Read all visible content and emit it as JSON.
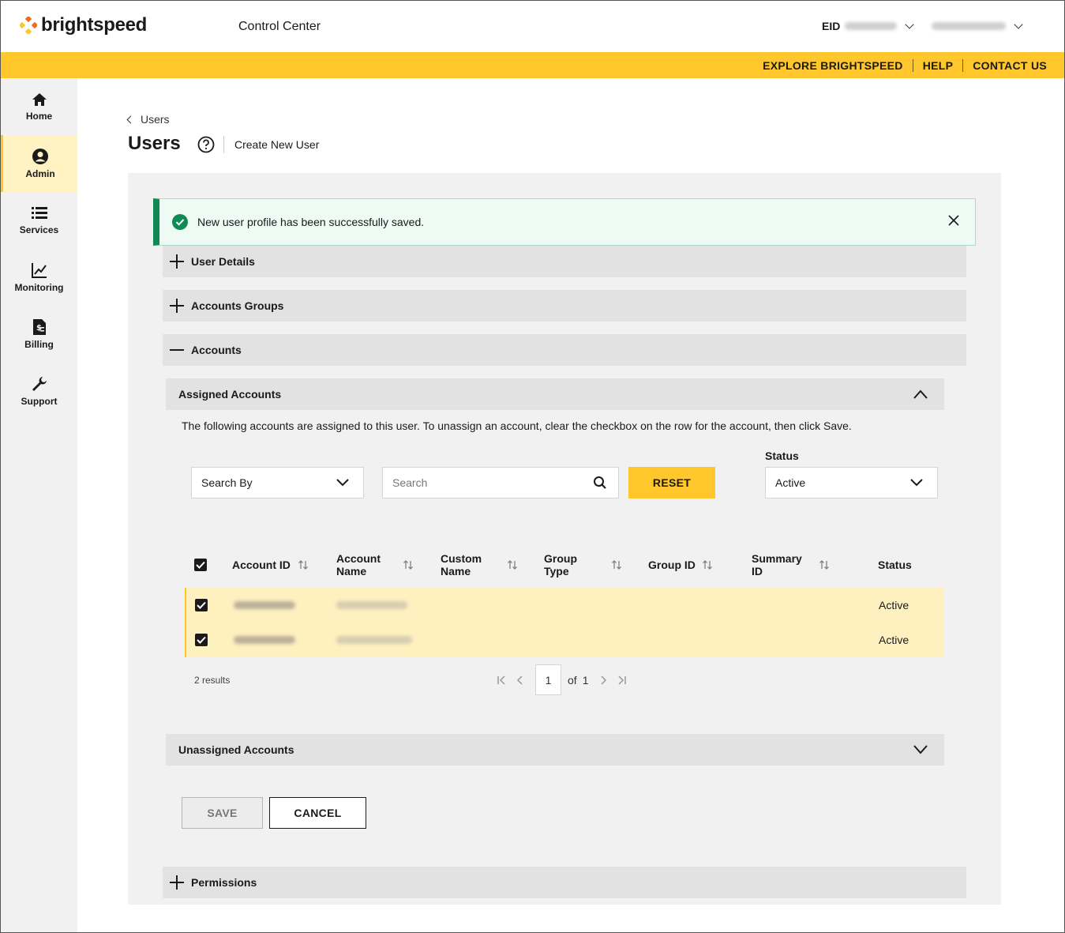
{
  "header": {
    "logo_text": "brightspeed",
    "app_title": "Control Center",
    "eid_label": "EID"
  },
  "topnav": {
    "items": [
      "EXPLORE BRIGHTSPEED",
      "HELP",
      "CONTACT US"
    ]
  },
  "sidebar": {
    "items": [
      {
        "label": "Home",
        "icon": "home-icon",
        "active": false
      },
      {
        "label": "Admin",
        "icon": "user-circle-icon",
        "active": true
      },
      {
        "label": "Services",
        "icon": "list-icon",
        "active": false
      },
      {
        "label": "Monitoring",
        "icon": "chart-icon",
        "active": false
      },
      {
        "label": "Billing",
        "icon": "invoice-icon",
        "active": false
      },
      {
        "label": "Support",
        "icon": "wrench-icon",
        "active": false
      }
    ]
  },
  "breadcrumb": {
    "back_label": "Users"
  },
  "page": {
    "title": "Users",
    "create_link": "Create New User"
  },
  "toast": {
    "message": "New user profile has been successfully saved."
  },
  "sections": {
    "user_details": "User Details",
    "accounts_groups": "Accounts Groups",
    "accounts": "Accounts",
    "permissions": "Permissions"
  },
  "assigned": {
    "title": "Assigned Accounts",
    "description": "The following accounts are assigned to this user. To unassign an account, clear the checkbox on the row for the account, then click Save.",
    "search_by": "Search By",
    "search_placeholder": "Search",
    "reset_label": "RESET",
    "status_label": "Status",
    "status_value": "Active",
    "columns": {
      "account_id": "Account ID",
      "account_name_1": "Account",
      "account_name_2": "Name",
      "custom_name_1": "Custom",
      "custom_name_2": "Name",
      "group_type_1": "Group",
      "group_type_2": "Type",
      "group_id": "Group ID",
      "summary_id_1": "Summary",
      "summary_id_2": "ID",
      "status": "Status"
    },
    "rows": [
      {
        "status": "Active"
      },
      {
        "status": "Active"
      }
    ],
    "results_label": "2 results",
    "page_current": "1",
    "page_of": "of",
    "page_total": "1"
  },
  "unassigned": {
    "title": "Unassigned Accounts"
  },
  "actions": {
    "save": "SAVE",
    "cancel": "CANCEL"
  },
  "colors": {
    "brand_yellow": "#ffc72c",
    "success_green": "#108a55",
    "row_highlight": "#fff0bf"
  }
}
